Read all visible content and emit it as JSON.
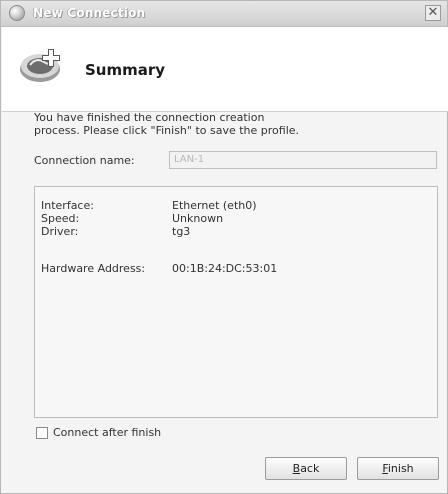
{
  "window": {
    "title": "New Connection",
    "close_glyph": "✕"
  },
  "header": {
    "title": "Summary",
    "icon": "network-connection-add-icon"
  },
  "intro": {
    "line1": "You have finished the connection creation",
    "line2": "process. Please click \"Finish\" to save the profile."
  },
  "connection": {
    "name_label": "Connection name:",
    "name_value": "LAN-1"
  },
  "details": {
    "interface_label": "Interface:",
    "interface_value": "Ethernet (eth0)",
    "speed_label": "Speed:",
    "speed_value": "Unknown",
    "driver_label": "Driver:",
    "driver_value": "tg3",
    "hw_label": "Hardware Address:",
    "hw_value": "00:1B:24:DC:53:01"
  },
  "options": {
    "connect_after_finish_label": "Connect after finish",
    "connect_after_finish_checked": false
  },
  "buttons": {
    "back_mnemonic": "B",
    "back_rest": "ack",
    "finish_mnemonic": "F",
    "finish_rest": "inish"
  },
  "colors": {
    "window_bg": "#f4f4f4",
    "header_bg": "#ffffff",
    "titlebar_text": "#ffffff"
  }
}
